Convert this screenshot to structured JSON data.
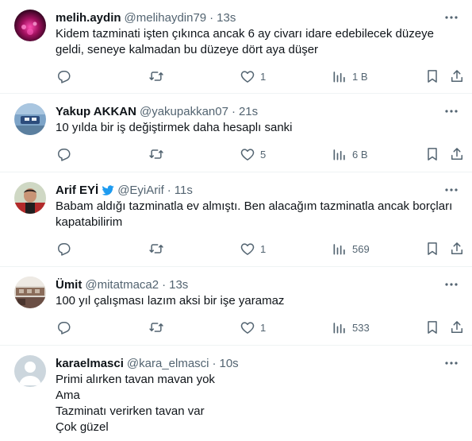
{
  "tweets": [
    {
      "name": "melih.aydin",
      "handle": "@melihaydin79",
      "time": "13s",
      "verified": false,
      "lines": [
        "Kidem tazminati işten çıkınca ancak 6 ay civarı idare edebilecek düzeye",
        "geldi, seneye kalmadan  bu düzeye dört aya düşer"
      ],
      "likes": "1",
      "views": "1 B",
      "replies": "",
      "retweets": ""
    },
    {
      "name": "Yakup AKKAN",
      "handle": "@yakupakkan07",
      "time": "21s",
      "verified": false,
      "lines": [
        "10 yılda bir iş değiştirmek daha hesaplı sanki"
      ],
      "likes": "5",
      "views": "6 B",
      "replies": "",
      "retweets": ""
    },
    {
      "name": "Arif EYİ",
      "handle": "@EyiArif",
      "time": "11s",
      "verified": true,
      "lines": [
        "Babam aldığı tazminatla ev almıştı. Ben alacağım tazminatla ancak borçları",
        "kapatabilirim"
      ],
      "likes": "1",
      "views": "569",
      "replies": "",
      "retweets": ""
    },
    {
      "name": "Ümit",
      "handle": "@mitatmaca2",
      "time": "13s",
      "verified": false,
      "lines": [
        "100 yıl çalışması lazım aksi bir işe yaramaz"
      ],
      "likes": "1",
      "views": "533",
      "replies": "",
      "retweets": ""
    },
    {
      "name": "karaelmasci",
      "handle": "@kara_elmasci",
      "time": "10s",
      "verified": false,
      "lines": [
        "Primi alırken tavan mavan yok",
        "Ama",
        "Tazminatı verirken tavan var",
        "Çok güzel"
      ],
      "likes": "",
      "views": "",
      "replies": "",
      "retweets": ""
    }
  ],
  "separator_dot": "·",
  "colors": {
    "text_primary": "#0f1419",
    "text_secondary": "#536471",
    "divider": "#eff3f4",
    "verified_blue": "#1d9bf0"
  },
  "icons": [
    "reply-icon",
    "retweet-icon",
    "like-icon",
    "views-icon",
    "bookmark-icon",
    "share-icon",
    "more-icon",
    "verified-icon"
  ]
}
